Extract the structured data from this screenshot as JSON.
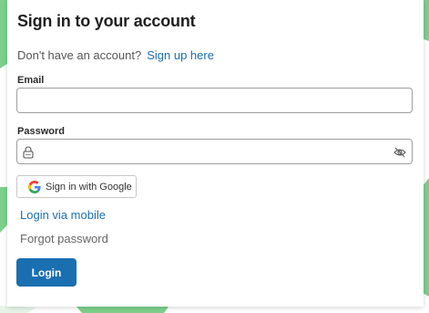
{
  "colors": {
    "accent": "#1a6fb0",
    "background_shapes": "#7ccf8a"
  },
  "signin": {
    "title": "Sign in to your account",
    "signup_prompt": "Don't have an account?",
    "signup_link": "Sign up here",
    "email_label": "Email",
    "email_value": "",
    "password_label": "Password",
    "password_value": "",
    "lock_icon": "lock-icon",
    "eye_icon": "eye-off-icon",
    "google_button_label": "Sign in with Google",
    "google_icon": "google-logo-icon",
    "mobile_link": "Login via mobile",
    "forgot_link": "Forgot password",
    "login_button_label": "Login"
  }
}
